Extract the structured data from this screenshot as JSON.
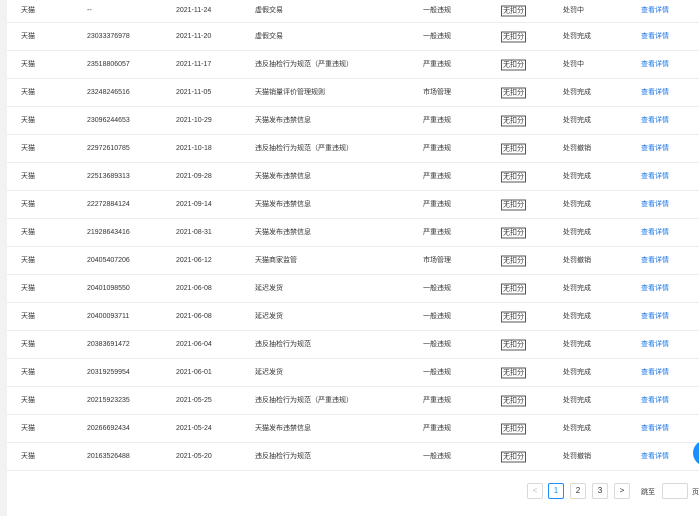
{
  "rows": [
    {
      "platform": "天猫",
      "id": "--",
      "date": "2021-11-24",
      "reason": "虚假交易",
      "type": "一般违规",
      "deduct": "无扣分",
      "status": "处罚中",
      "action": "查看详情"
    },
    {
      "platform": "天猫",
      "id": "23033376978",
      "date": "2021-11-20",
      "reason": "虚假交易",
      "type": "一般违规",
      "deduct": "无扣分",
      "status": "处罚完成",
      "action": "查看详情"
    },
    {
      "platform": "天猫",
      "id": "23518806057",
      "date": "2021-11-17",
      "reason": "违反抽检行为规范（严重违规）",
      "type": "严重违规",
      "deduct": "无扣分",
      "status": "处罚中",
      "action": "查看详情"
    },
    {
      "platform": "天猫",
      "id": "23248246516",
      "date": "2021-11-05",
      "reason": "天猫销量评价管理规则",
      "type": "市场管理",
      "deduct": "无扣分",
      "status": "处罚完成",
      "action": "查看详情"
    },
    {
      "platform": "天猫",
      "id": "23096244653",
      "date": "2021-10-29",
      "reason": "天猫发布违禁信息",
      "type": "严重违规",
      "deduct": "无扣分",
      "status": "处罚完成",
      "action": "查看详情"
    },
    {
      "platform": "天猫",
      "id": "22972610785",
      "date": "2021-10-18",
      "reason": "违反抽检行为规范（严重违规）",
      "type": "严重违规",
      "deduct": "无扣分",
      "status": "处罚撤销",
      "action": "查看详情"
    },
    {
      "platform": "天猫",
      "id": "22513689313",
      "date": "2021-09-28",
      "reason": "天猫发布违禁信息",
      "type": "严重违规",
      "deduct": "无扣分",
      "status": "处罚完成",
      "action": "查看详情"
    },
    {
      "platform": "天猫",
      "id": "22272884124",
      "date": "2021-09-14",
      "reason": "天猫发布违禁信息",
      "type": "严重违规",
      "deduct": "无扣分",
      "status": "处罚完成",
      "action": "查看详情"
    },
    {
      "platform": "天猫",
      "id": "21928643416",
      "date": "2021-08-31",
      "reason": "天猫发布违禁信息",
      "type": "严重违规",
      "deduct": "无扣分",
      "status": "处罚完成",
      "action": "查看详情"
    },
    {
      "platform": "天猫",
      "id": "20405407206",
      "date": "2021-06-12",
      "reason": "天猫商家监管",
      "type": "市场管理",
      "deduct": "无扣分",
      "status": "处罚撤销",
      "action": "查看详情"
    },
    {
      "platform": "天猫",
      "id": "20401098550",
      "date": "2021-06-08",
      "reason": "延迟发货",
      "type": "一般违规",
      "deduct": "无扣分",
      "status": "处罚完成",
      "action": "查看详情"
    },
    {
      "platform": "天猫",
      "id": "20400093711",
      "date": "2021-06-08",
      "reason": "延迟发货",
      "type": "一般违规",
      "deduct": "无扣分",
      "status": "处罚完成",
      "action": "查看详情"
    },
    {
      "platform": "天猫",
      "id": "20383691472",
      "date": "2021-06-04",
      "reason": "违反抽检行为规范",
      "type": "一般违规",
      "deduct": "无扣分",
      "status": "处罚完成",
      "action": "查看详情"
    },
    {
      "platform": "天猫",
      "id": "20319259954",
      "date": "2021-06-01",
      "reason": "延迟发货",
      "type": "一般违规",
      "deduct": "无扣分",
      "status": "处罚完成",
      "action": "查看详情"
    },
    {
      "platform": "天猫",
      "id": "20215923235",
      "date": "2021-05-25",
      "reason": "违反抽检行为规范（严重违规）",
      "type": "严重违规",
      "deduct": "无扣分",
      "status": "处罚完成",
      "action": "查看详情"
    },
    {
      "platform": "天猫",
      "id": "20266692434",
      "date": "2021-05-24",
      "reason": "天猫发布违禁信息",
      "type": "严重违规",
      "deduct": "无扣分",
      "status": "处罚完成",
      "action": "查看详情"
    },
    {
      "platform": "天猫",
      "id": "20163526488",
      "date": "2021-05-20",
      "reason": "违反抽检行为规范",
      "type": "一般违规",
      "deduct": "无扣分",
      "status": "处罚撤销",
      "action": "查看详情"
    }
  ],
  "pagination": {
    "prev": "<",
    "pages": [
      "1",
      "2",
      "3"
    ],
    "next": ">",
    "jump_label": "跳至",
    "jump_value": "",
    "suffix": "页"
  },
  "colors": {
    "link": "#1a73e8",
    "active_page": "#1890ff",
    "float_button": "#1890ff"
  }
}
